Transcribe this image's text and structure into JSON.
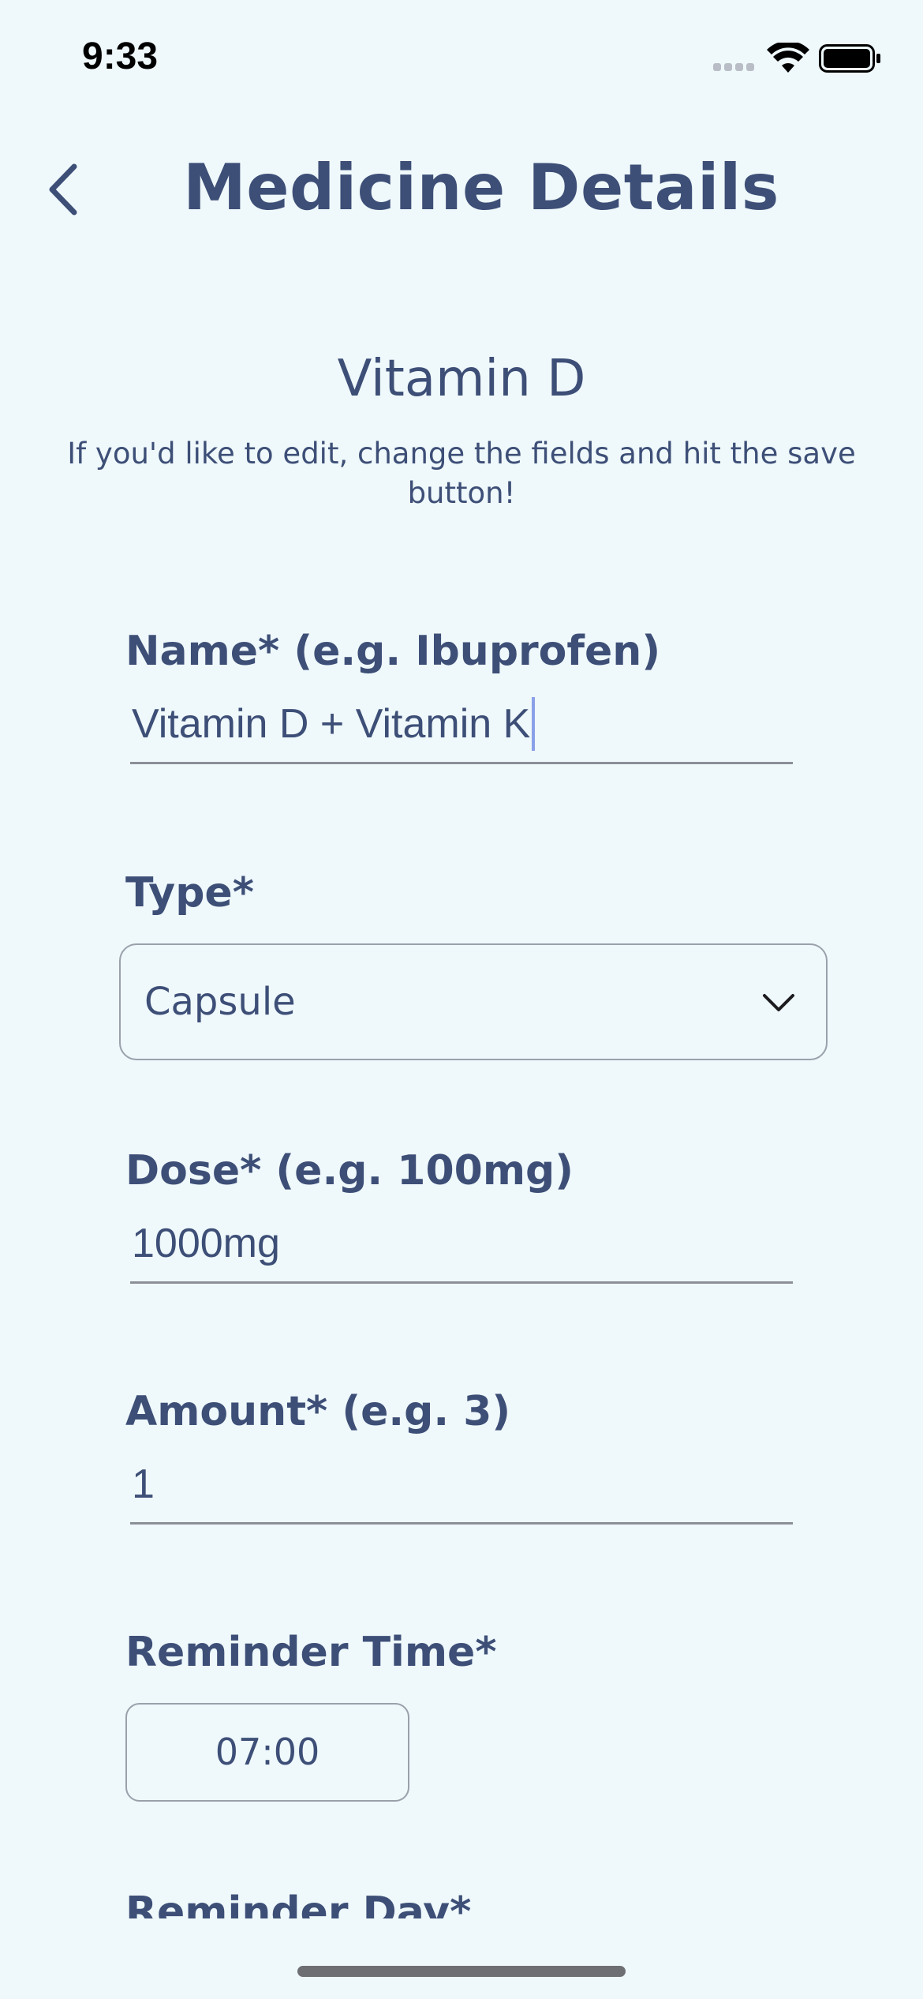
{
  "status_bar": {
    "time": "9:33",
    "icons": [
      "cellular-signal-icon",
      "wifi-icon",
      "battery-icon"
    ]
  },
  "header": {
    "back_icon": "chevron-left-icon",
    "title": "Medicine Details"
  },
  "medicine": {
    "name": "Vitamin D",
    "helper_text": "If you'd like to edit, change the fields and hit the save button!"
  },
  "form": {
    "name_field": {
      "label": "Name* (e.g. Ibuprofen)",
      "value": "Vitamin D + Vitamin K"
    },
    "type_field": {
      "label": "Type*",
      "selected": "Capsule",
      "icon": "chevron-down-icon"
    },
    "dose_field": {
      "label": "Dose* (e.g. 100mg)",
      "value": "1000mg"
    },
    "amount_field": {
      "label": "Amount* (e.g. 3)",
      "value": "1"
    },
    "reminder_time": {
      "label": "Reminder Time*",
      "value": "07:00"
    },
    "reminder_day": {
      "label": "Reminder Day*"
    }
  },
  "colors": {
    "background": "#eff8fb",
    "primary_text": "#3d4f77",
    "border": "#9aa1ab",
    "caret": "#8aa0e8"
  }
}
